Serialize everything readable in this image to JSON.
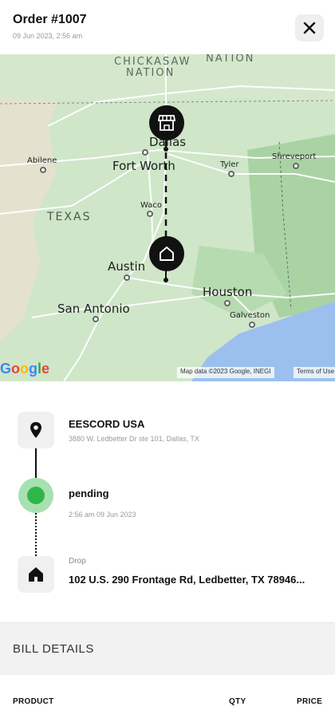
{
  "header": {
    "title": "Order #1007",
    "date": "09 Jun 2023, 2:56 am",
    "close_icon": "close-icon"
  },
  "map": {
    "labels": {
      "chickasaw": "CHICKASAW",
      "nation_left": "NATION",
      "nation_right": "NATION",
      "dallas": "Dallas",
      "fort_worth": "Fort Worth",
      "abilene": "Abilene",
      "tyler": "Tyler",
      "shreveport": "Shreveport",
      "texas": "TEXAS",
      "waco": "Waco",
      "austin": "Austin",
      "houston": "Houston",
      "san_antonio": "San Antonio",
      "galveston": "Galveston"
    },
    "google": [
      "G",
      "o",
      "o",
      "g",
      "l",
      "e"
    ],
    "google_colors": [
      "#4285F4",
      "#EA4335",
      "#FBBC05",
      "#4285F4",
      "#34A853",
      "#EA4335"
    ],
    "credit": "Map data ©2023 Google, INEGI",
    "terms": "Terms of Use",
    "store_pin_icon": "store-icon",
    "home_pin_icon": "home-icon"
  },
  "timeline": {
    "store": {
      "icon": "location-pin-icon",
      "name": "EESCORD USA",
      "address": "3880 W. Ledbetter Dr ste 101, Dallas, TX"
    },
    "status": {
      "label": "pending",
      "time": "2:56 am 09 Jun 2023",
      "color": "#2fb54a"
    },
    "drop": {
      "icon": "home-icon",
      "label": "Drop",
      "address": "102 U.S. 290 Frontage Rd, Ledbetter, TX 78946..."
    }
  },
  "bill": {
    "title": "BILL DETAILS",
    "columns": [
      "PRODUCT",
      "QTY",
      "PRICE"
    ]
  }
}
